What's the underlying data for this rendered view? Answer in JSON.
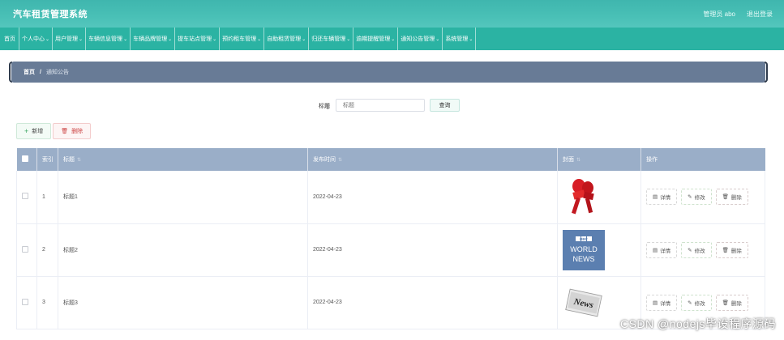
{
  "header": {
    "title": "汽车租赁管理系统",
    "user": "管理员 abo",
    "logout": "退出登录"
  },
  "nav": {
    "items": [
      {
        "label": "首页",
        "dropdown": false
      },
      {
        "label": "个人中心",
        "dropdown": true
      },
      {
        "label": "用户管理",
        "dropdown": true
      },
      {
        "label": "车辆信息管理",
        "dropdown": true
      },
      {
        "label": "车辆品牌管理",
        "dropdown": true
      },
      {
        "label": "提车站点管理",
        "dropdown": true
      },
      {
        "label": "预约租车管理",
        "dropdown": true
      },
      {
        "label": "自助租赁管理",
        "dropdown": true
      },
      {
        "label": "归还车辆管理",
        "dropdown": true
      },
      {
        "label": "逾期提醒管理",
        "dropdown": true
      },
      {
        "label": "通知公告管理",
        "dropdown": true
      },
      {
        "label": "系统管理",
        "dropdown": true
      }
    ]
  },
  "breadcrumb": {
    "home": "首页",
    "separator": "/",
    "current": "通知公告"
  },
  "search": {
    "label": "标题",
    "placeholder": "标题",
    "button": "查询"
  },
  "actions": {
    "add": "新增",
    "delete": "删除"
  },
  "table": {
    "headers": {
      "index": "索引",
      "title": "标题",
      "date": "发布时间",
      "cover": "封面",
      "ops": "操作"
    },
    "rows": [
      {
        "index": "1",
        "title": "标题1",
        "date": "2022-04-23",
        "cover": "microphone-image"
      },
      {
        "index": "2",
        "title": "标题2",
        "date": "2022-04-23",
        "cover": "bbc-world-news-image"
      },
      {
        "index": "3",
        "title": "标题3",
        "date": "2022-04-23",
        "cover": "news-paper-image"
      }
    ],
    "row_actions": {
      "detail": "详情",
      "edit": "修改",
      "delete": "删除"
    },
    "bbc_text": [
      "BBC",
      "WORLD",
      "NEWS"
    ],
    "news_text": "News"
  },
  "watermark": "CSDN @nodejs毕设程序源码",
  "colors": {
    "topbar": "#49c0b6",
    "navbar": "#2bb3a3",
    "breadcrumb": "#687b96",
    "table_header": "#9aaec8"
  }
}
